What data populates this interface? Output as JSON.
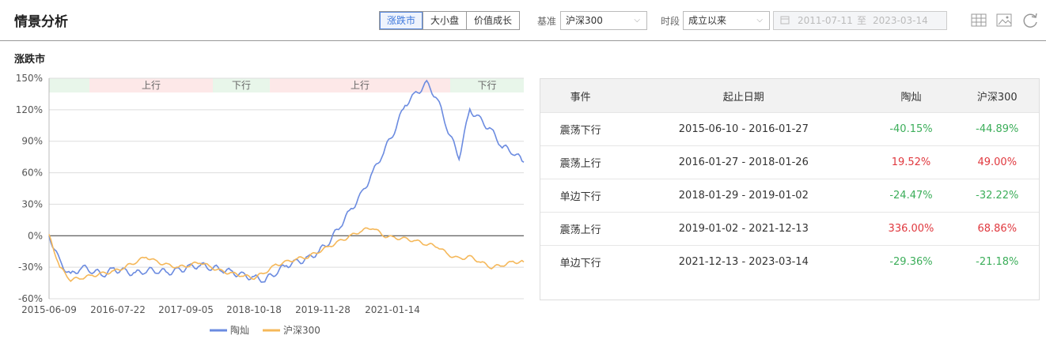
{
  "header": {
    "title": "情景分析",
    "segments": [
      "涨跌市",
      "大小盘",
      "价值成长"
    ],
    "benchmark_label": "基准",
    "benchmark_value": "沪深300",
    "period_label": "时段",
    "period_value": "成立以来",
    "date_start": "2011-07-11",
    "date_sep": "至",
    "date_end": "2023-03-14"
  },
  "section_title": "涨跌市",
  "chart_data": {
    "type": "line",
    "y_ticks": [
      "150%",
      "120%",
      "90%",
      "60%",
      "30%",
      "0%",
      "-30%",
      "-60%"
    ],
    "ylim": [
      -60,
      150
    ],
    "x_ticks": [
      "2015-06-09",
      "2016-07-22",
      "2017-09-05",
      "2018-10-18",
      "2019-11-28",
      "2021-01-14"
    ],
    "regime_bands": [
      {
        "label": "",
        "kind": "down"
      },
      {
        "label": "上行",
        "kind": "up"
      },
      {
        "label": "下行",
        "kind": "down"
      },
      {
        "label": "上行",
        "kind": "up"
      },
      {
        "label": "下行",
        "kind": "down"
      }
    ],
    "series": [
      {
        "name": "陶灿",
        "color": "#6b8be0",
        "values": [
          0,
          -25,
          -38,
          -30,
          -33,
          -37,
          -32,
          -34,
          -36,
          -33,
          -33,
          -35,
          -33,
          -30,
          -28,
          -30,
          -32,
          -35,
          -38,
          -40,
          -42,
          -35,
          -28,
          -25,
          -22,
          -15,
          -5,
          10,
          25,
          40,
          60,
          80,
          100,
          125,
          135,
          145,
          130,
          100,
          75,
          120,
          110,
          100,
          85,
          80,
          70
        ]
      },
      {
        "name": "沪深300",
        "color": "#f5b85a",
        "values": [
          0,
          -30,
          -42,
          -40,
          -38,
          -36,
          -34,
          -30,
          -25,
          -20,
          -25,
          -28,
          -30,
          -28,
          -25,
          -30,
          -34,
          -36,
          -38,
          -40,
          -35,
          -28,
          -25,
          -22,
          -20,
          -15,
          -10,
          -5,
          0,
          5,
          8,
          0,
          -2,
          -3,
          -5,
          -8,
          -10,
          -18,
          -22,
          -20,
          -25,
          -30,
          -28,
          -25,
          -25
        ]
      }
    ]
  },
  "table": {
    "headers": [
      "事件",
      "起止日期",
      "陶灿",
      "沪深300"
    ],
    "rows": [
      {
        "event": "震荡下行",
        "range": "2015-06-10 - 2016-01-27",
        "fund": "-40.15%",
        "bench": "-44.89%",
        "fund_sign": "neg",
        "bench_sign": "neg"
      },
      {
        "event": "震荡上行",
        "range": "2016-01-27 - 2018-01-26",
        "fund": "19.52%",
        "bench": "49.00%",
        "fund_sign": "pos",
        "bench_sign": "pos"
      },
      {
        "event": "单边下行",
        "range": "2018-01-29 - 2019-01-02",
        "fund": "-24.47%",
        "bench": "-32.22%",
        "fund_sign": "neg",
        "bench_sign": "neg"
      },
      {
        "event": "震荡上行",
        "range": "2019-01-02 - 2021-12-13",
        "fund": "336.00%",
        "bench": "68.86%",
        "fund_sign": "pos",
        "bench_sign": "pos"
      },
      {
        "event": "单边下行",
        "range": "2021-12-13 - 2023-03-14",
        "fund": "-29.36%",
        "bench": "-21.18%",
        "fund_sign": "neg",
        "bench_sign": "neg"
      }
    ]
  }
}
